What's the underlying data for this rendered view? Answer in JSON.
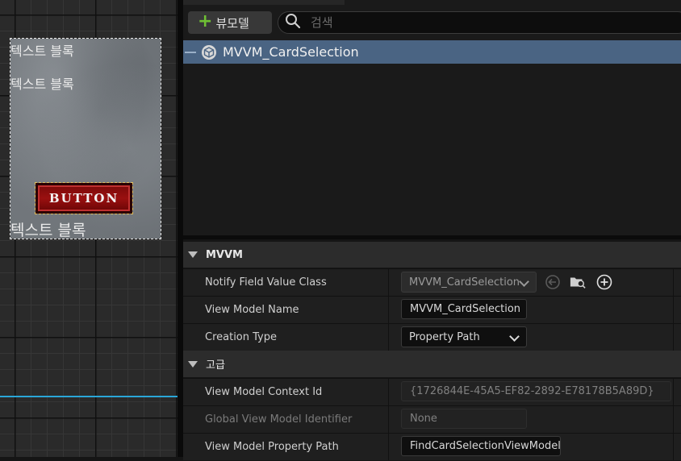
{
  "canvas": {
    "card": {
      "text_blocks": [
        "텍스트 블록",
        "텍스트 블록",
        "텍스트 블록"
      ],
      "button_label": "BUTTON"
    }
  },
  "viewmodels": {
    "add_button_label": "뷰모델",
    "search_placeholder": "검색",
    "items": [
      {
        "name": "MVVM_CardSelection",
        "icon": "viewmodel-cube-icon"
      }
    ]
  },
  "details": {
    "sections": [
      {
        "title": "MVVM",
        "rows": [
          {
            "label": "Notify Field Value Class",
            "type": "combo",
            "value": "MVVM_CardSelection",
            "icons": [
              "browse-back-icon",
              "folder-search-icon",
              "add-circle-icon"
            ]
          },
          {
            "label": "View Model Name",
            "type": "text",
            "value": "MVVM_CardSelection"
          },
          {
            "label": "Creation Type",
            "type": "combo",
            "value": "Property Path"
          }
        ]
      },
      {
        "title": "고급",
        "rows": [
          {
            "label": "View Model Context Id",
            "type": "readonly",
            "value": "{1726844E-45A5-EF82-2892-E78178B5A89D}"
          },
          {
            "label": "Global View Model Identifier",
            "type": "readonly",
            "value": "None"
          },
          {
            "label": "View Model Property Path",
            "type": "text",
            "value": "FindCardSelectionViewModel"
          }
        ]
      }
    ]
  },
  "colors": {
    "selection": "#4a6483",
    "accent_green": "#6fc034",
    "guide_line": "#2aa6d8",
    "button_red": "#9a1010"
  }
}
